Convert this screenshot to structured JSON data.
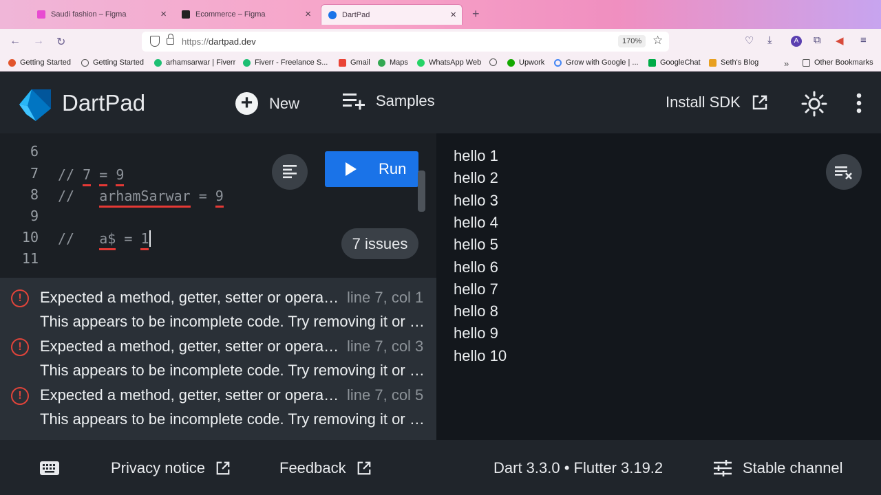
{
  "browser": {
    "tabs": [
      {
        "title": "Saudi fashion – Figma",
        "color": "#e84bd1"
      },
      {
        "title": "Ecommerce – Figma",
        "color": "#222222"
      },
      {
        "title": "DartPad",
        "color": "#1a73e8"
      }
    ],
    "new_tab": "+",
    "url_protocol": "https://",
    "url_host": "dartpad.dev",
    "zoom": "170%",
    "bookmarks": [
      {
        "label": "Getting Started",
        "color": "#e2552c"
      },
      {
        "label": "Getting Started",
        "color": "#6a6a6a"
      },
      {
        "label": "arhamsarwar | Fiverr",
        "color": "#1dbf73"
      },
      {
        "label": "Fiverr - Freelance S...",
        "color": "#1dbf73"
      },
      {
        "label": "Gmail",
        "color": "#ea4335"
      },
      {
        "label": "Maps",
        "color": "#34a853"
      },
      {
        "label": "WhatsApp Web",
        "color": "#25d366"
      },
      {
        "label": "Upwork",
        "color": "#14a800"
      },
      {
        "label": "Grow with Google | ...",
        "color": "#4285f4"
      },
      {
        "label": "GoogleChat",
        "color": "#00ac47"
      },
      {
        "label": "Seth's Blog",
        "color": "#e8a020"
      }
    ],
    "other_bookmarks": "Other Bookmarks"
  },
  "app": {
    "title": "DartPad",
    "new_label": "New",
    "samples_label": "Samples",
    "install_label": "Install SDK"
  },
  "editor": {
    "lines": [
      {
        "num": "6"
      },
      {
        "num": "7"
      },
      {
        "num": "8"
      },
      {
        "num": "9"
      },
      {
        "num": "10"
      },
      {
        "num": "11"
      }
    ],
    "code": {
      "l7_prefix": "// ",
      "l7_a": "7",
      "l7_eq": "=",
      "l7_b": "9",
      "l8_prefix": "//   ",
      "l8_a": "arhamSarwar",
      "l8_eq": " = ",
      "l8_b": "9",
      "l10_prefix": "//   ",
      "l10_a": "a$",
      "l10_eq": " = ",
      "l10_b": "1"
    },
    "run_label": "Run",
    "issues_label": "7 issues"
  },
  "problems": [
    {
      "message": "Expected a method, getter, setter or operator declaration.",
      "location": "line 7, col 1",
      "detail": "This appears to be incomplete code. Try removing it or completing it."
    },
    {
      "message": "Expected a method, getter, setter or operator declaration.",
      "location": "line 7, col 3",
      "detail": "This appears to be incomplete code. Try removing it or completing it."
    },
    {
      "message": "Expected a method, getter, setter or operator declaration.",
      "location": "line 7, col 5",
      "detail": "This appears to be incomplete code. Try removing it or completing it."
    }
  ],
  "console": [
    "hello 1",
    "hello 2",
    "hello 3",
    "hello 4",
    "hello 5",
    "hello 6",
    "hello 7",
    "hello 8",
    "hello 9",
    "hello 10"
  ],
  "footer": {
    "privacy": "Privacy notice",
    "feedback": "Feedback",
    "version": "Dart 3.3.0 • Flutter 3.19.2",
    "channel": "Stable channel"
  }
}
